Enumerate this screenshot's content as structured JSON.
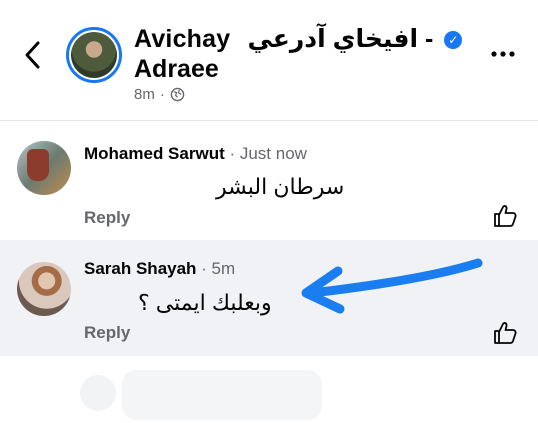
{
  "header": {
    "title_line1": "Avichay",
    "title_arabic": "افيخاي آدرعي -",
    "title_line2": "Adraee",
    "time": "8m",
    "separator": "·",
    "verified_icon": "verified-badge-icon",
    "globe_icon": "globe-icon",
    "back_icon": "chevron-left-icon",
    "more_icon": "more-dots-icon"
  },
  "comments": [
    {
      "name": "Mohamed Sarwut",
      "time": " · Just now",
      "text": "سرطان البشر",
      "reply": "Reply"
    },
    {
      "name": "Sarah Shayah",
      "time": " · 5m",
      "text": "وبعلبك ايمتى ؟",
      "reply": "Reply"
    }
  ],
  "colors": {
    "accent": "#1877f2",
    "highlight_bg": "#f0f2f5",
    "secondary_text": "#65676b"
  }
}
